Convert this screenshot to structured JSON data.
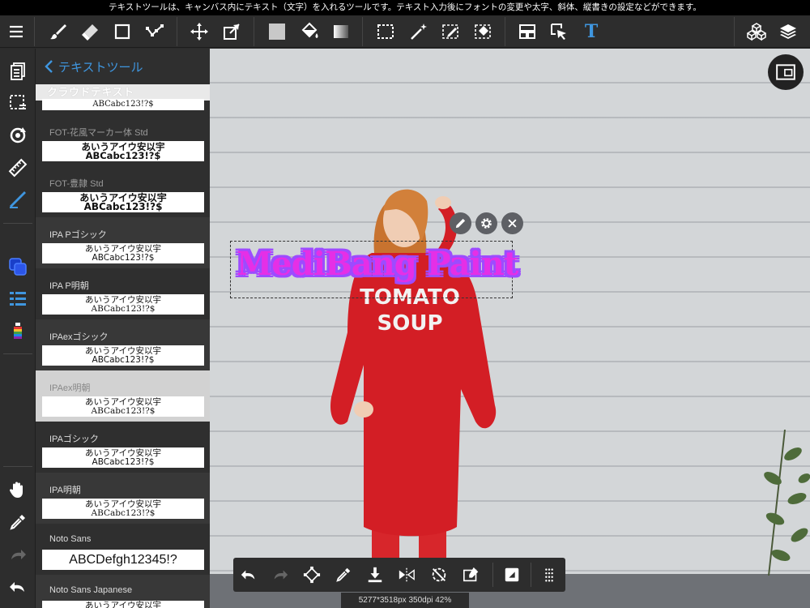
{
  "hint_bar": {
    "text": "テキストツールは、キャンバス内にテキスト（文字）を入れるツールです。テキスト入力後にフォントの変更や太字、斜体、縦書きの設定などができます。"
  },
  "toolbar": {
    "items": [
      "menu-icon",
      "brush-icon",
      "eraser-icon",
      "shape-rect-icon",
      "polyline-icon",
      "move-icon",
      "transform-icon",
      "fill-color-swatch",
      "bucket-icon",
      "gradient-icon",
      "select-rect-icon",
      "magic-wand-icon",
      "select-pen-icon",
      "select-eraser-icon",
      "layout-icon",
      "select-layer-icon",
      "text-icon",
      "3d-material-icon",
      "layers-icon"
    ],
    "text_tool_glyph": "T"
  },
  "left_rail": {
    "items": [
      "pages-icon",
      "selection-icon",
      "rotate-icon",
      "ruler-icon",
      "pen-icon",
      "color-icon",
      "layer-list-icon",
      "brush-color-icon",
      "hand-icon",
      "eyedropper-icon",
      "redo-icon",
      "undo-icon"
    ]
  },
  "font_panel": {
    "back_label": "テキストツール",
    "cloud_header": "クラウドテキスト",
    "cloud_preview": "ABCabc123!?$",
    "fonts": [
      {
        "name": "FOT-花風マーカー体 Std",
        "line1": "あいうアイウ安以宇",
        "line2": "ABCabc123!?$",
        "style": "bold",
        "state": "dim"
      },
      {
        "name": "FOT-豊隷 Std",
        "line1": "あいうアイウ安以宇",
        "line2": "ABCabc123!?$",
        "style": "bold",
        "state": "dim"
      },
      {
        "name": "IPA Pゴシック",
        "line1": "あいうアイウ安以宇",
        "line2": "ABCabc123!?$",
        "style": "sans",
        "state": "alt"
      },
      {
        "name": "IPA P明朝",
        "line1": "あいうアイウ安以宇",
        "line2": "ABCabc123!?$",
        "style": "serif",
        "state": ""
      },
      {
        "name": "IPAexゴシック",
        "line1": "あいうアイウ安以宇",
        "line2": "ABCabc123!?$",
        "style": "sans",
        "state": "alt"
      },
      {
        "name": "IPAex明朝",
        "line1": "あいうアイウ安以宇",
        "line2": "ABCabc123!?$",
        "style": "serif",
        "state": "sel"
      },
      {
        "name": "IPAゴシック",
        "line1": "あいうアイウ安以宇",
        "line2": "ABCabc123!?$",
        "style": "sans",
        "state": ""
      },
      {
        "name": "IPA明朝",
        "line1": "あいうアイウ安以宇",
        "line2": "ABCabc123!?$",
        "style": "serif",
        "state": "alt"
      },
      {
        "name": "Noto Sans",
        "line1": "ABCDefgh12345!?",
        "line2": "",
        "style": "big",
        "state": ""
      },
      {
        "name": "Noto Sans Japanese",
        "line1": "あいうアイウ安以宇",
        "line2": "",
        "style": "sans",
        "state": "alt"
      }
    ]
  },
  "canvas": {
    "text_object": "MediBang Paint",
    "sweatshirt_line1": "TOMATO",
    "sweatshirt_line2": "SOUP",
    "controls": [
      "edit-pen-icon",
      "settings-gear-icon",
      "close-x-icon"
    ]
  },
  "bottom_toolbar": {
    "items": [
      "undo-icon",
      "redo-icon",
      "transform-icon",
      "eyedropper-icon",
      "save-icon",
      "flip-icon",
      "rotate-reset-icon",
      "eraser-clear-icon",
      "fullscreen-icon",
      "more-dots-icon"
    ]
  },
  "status": {
    "text": "5277*3518px 350dpi 42%"
  },
  "colors": {
    "accent": "#3f96df",
    "text_fill": "#e52fe6",
    "text_outline": "#9d4bff",
    "sweatshirt": "#d31e25"
  }
}
